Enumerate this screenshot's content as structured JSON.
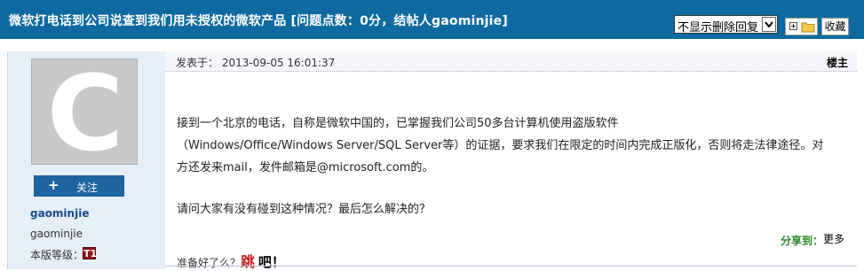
{
  "title": "微软打电话到公司说查到我们用未授权的微软产品 [问题点数：0分，结帖人gaominjie]",
  "toolbar": {
    "reply_filter_selected": "不显示删除回复",
    "favorite_label": "收藏"
  },
  "user": {
    "avatar_letter": "C",
    "follow_label": "关注",
    "follow_plus": "+",
    "username_link": "gaominjie",
    "nickname": "gaominjie",
    "level_label": "本版等级：",
    "level_badge": "T1"
  },
  "post": {
    "posted_label": "发表于：",
    "posted_time": "2013-09-05 16:01:37",
    "floor_label": "楼主",
    "lines": [
      "接到一个北京的电话，自称是微软中国的，已掌握我们公司50多台计算机使用盗版软件",
      "（Windows/Office/Windows Server/SQL Server等）的证据，要求我们在限定的时间内完成正版化，否则将走法律途径。对",
      "方还发来mail，发件邮箱是@microsoft.com的。",
      "请问大家有没有碰到这种情况？最后怎么解决的？"
    ],
    "share_label": "分享到：",
    "more_label": "更多",
    "signature_prefix": "准备好了么？",
    "signature_jump": "跳",
    "signature_ba": "吧",
    "signature_suffix": "！"
  },
  "colors": {
    "title_bar": "#0e6aa0",
    "user_panel": "#e6eef8",
    "follow_button": "#1e64a0",
    "share_green": "#2a8a2a",
    "jump_red": "#c81e1e"
  }
}
